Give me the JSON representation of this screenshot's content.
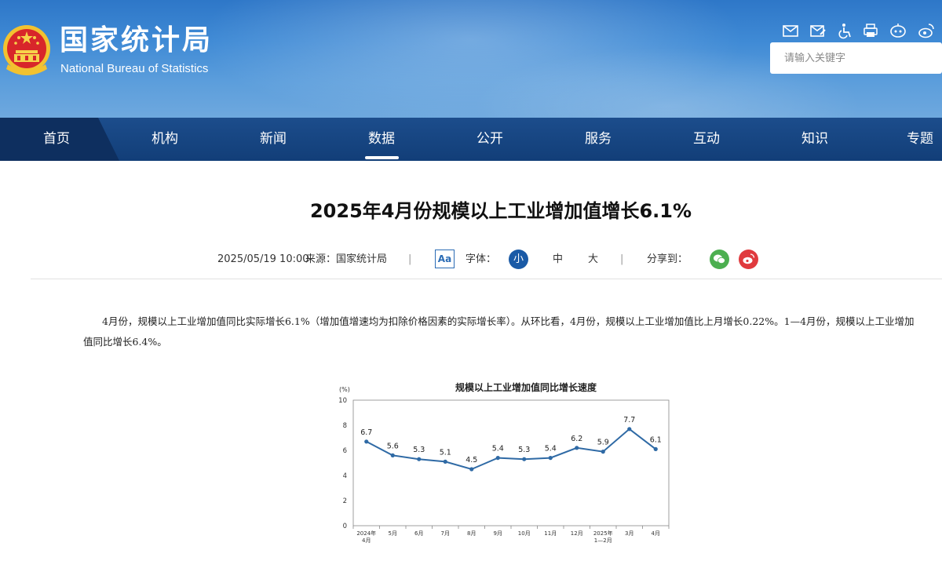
{
  "header": {
    "logo_cn": "国家统计局",
    "logo_en": "National Bureau of Statistics",
    "tool_icons": [
      "mail-icon",
      "mail-edit-icon",
      "accessibility-icon",
      "print-icon",
      "robot-icon",
      "weibo-icon"
    ],
    "search": {
      "placeholder": "请输入关键字"
    }
  },
  "nav": {
    "items": [
      {
        "label": "首页"
      },
      {
        "label": "机构"
      },
      {
        "label": "新闻"
      },
      {
        "label": "数据"
      },
      {
        "label": "公开"
      },
      {
        "label": "服务"
      },
      {
        "label": "互动"
      },
      {
        "label": "知识"
      },
      {
        "label": "专题"
      }
    ],
    "active": "数据"
  },
  "article": {
    "title": "2025年4月份规模以上工业增加值增长6.1%",
    "date": "2025/05/19 10:00",
    "source": "来源：国家统计局",
    "font_icon": "Aa",
    "font_label": "字体：",
    "font_sizes": [
      "小",
      "中",
      "大"
    ],
    "share_label": "分享到：",
    "share_icons": [
      "wechat-icon",
      "weibo-icon"
    ],
    "paragraph": "4月份，规模以上工业增加值同比实际增长6.1%（增加值增速均为扣除价格因素的实际增长率）。从环比看，4月份，规模以上工业增加值比上月增长0.22%。1—4月份，规模以上工业增加值同比增长6.4%。"
  },
  "chart_data": {
    "type": "line",
    "title": "规模以上工业增加值同比增长速度",
    "ylabel": "(%)",
    "ylim": [
      0,
      10
    ],
    "yticks": [
      0,
      2,
      4,
      6,
      8,
      10
    ],
    "categories": [
      [
        "2024年",
        "4月"
      ],
      [
        "5月"
      ],
      [
        "6月"
      ],
      [
        "7月"
      ],
      [
        "8月"
      ],
      [
        "9月"
      ],
      [
        "10月"
      ],
      [
        "11月"
      ],
      [
        "12月"
      ],
      [
        "2025年",
        "1—2月"
      ],
      [
        "3月"
      ],
      [
        "4月"
      ]
    ],
    "values": [
      6.7,
      5.6,
      5.3,
      5.1,
      4.5,
      5.4,
      5.3,
      5.4,
      6.2,
      5.9,
      7.7,
      6.1
    ],
    "data_labels": [
      "6.7",
      "5.6",
      "5.3",
      "5.1",
      "4.5",
      "5.4",
      "5.3",
      "5.4",
      "6.2",
      "5.9",
      "7.7",
      "6.1"
    ],
    "grid": false,
    "line_color": "#2f6aa5"
  }
}
